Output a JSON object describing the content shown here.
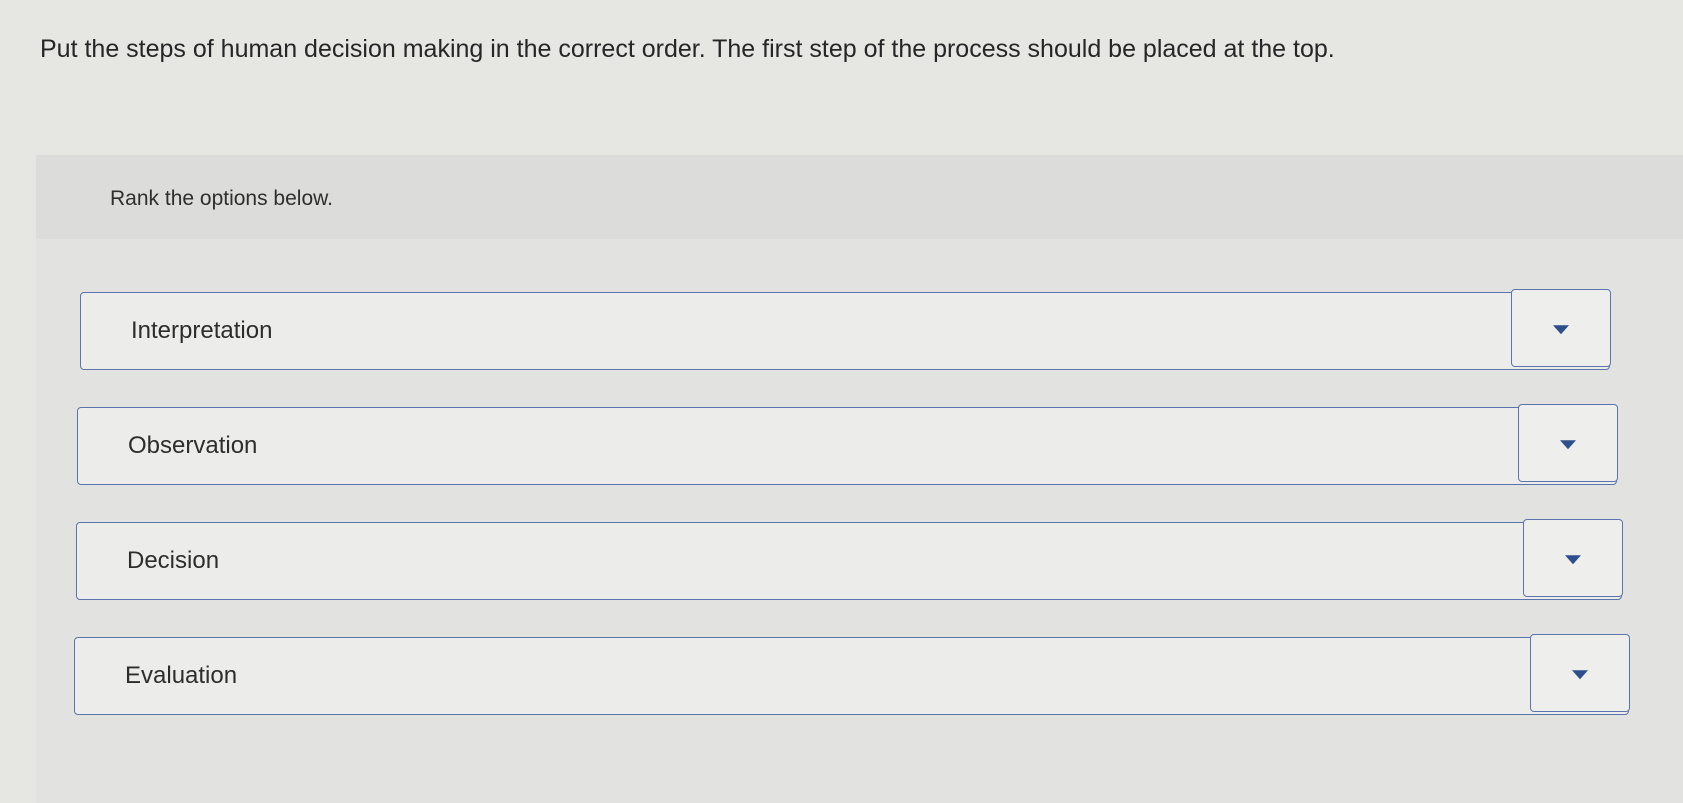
{
  "question": {
    "text": "Put the steps of human decision making in the correct order. The first step of the process should be placed at the top."
  },
  "rank": {
    "instruction": "Rank the options below.",
    "items": [
      {
        "label": "Interpretation",
        "dropdown_icon": "caret-down"
      },
      {
        "label": "Observation",
        "dropdown_icon": "caret-down"
      },
      {
        "label": "Decision",
        "dropdown_icon": "caret-down"
      },
      {
        "label": "Evaluation",
        "dropdown_icon": "caret-down"
      }
    ]
  },
  "colors": {
    "border": "#5b74ad",
    "caret": "#2c4f8c",
    "background": "#e6e6e3"
  }
}
